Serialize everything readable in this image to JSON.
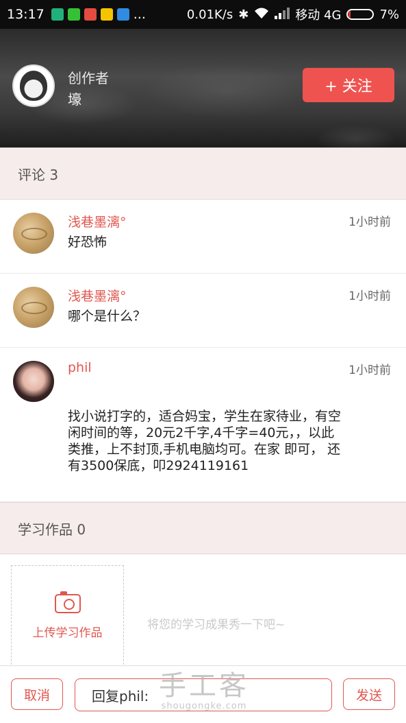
{
  "status_bar": {
    "time": "13:17",
    "dots": "...",
    "speed": "0.01K/s",
    "carrier": "移动 4G",
    "battery_percent": "7%",
    "battery_level": 0.07,
    "battery_color": "#e53935"
  },
  "header": {
    "author_label": "创作者",
    "author_name": "壕",
    "follow_label": "+ 关注"
  },
  "comments_section": {
    "title": "评论 3",
    "items": [
      {
        "name": "浅巷墨漓°",
        "time": "1小时前",
        "text": "好恐怖"
      },
      {
        "name": "浅巷墨漓°",
        "time": "1小时前",
        "text": "哪个是什么？"
      },
      {
        "name": "phil",
        "time": "1小时前",
        "text": "找小说打字的，适合妈宝，学生在家待业，有空闲时间的等，20元2千字,4千字=40元，，以此类推，上不封顶,手机电脑均可。在家 即可， 还有3500保底，叩2924119161"
      }
    ]
  },
  "works_section": {
    "title": "学习作品 0",
    "upload_label": "上传学习作品",
    "hint": "将您的学习成果秀一下吧~"
  },
  "reply_bar": {
    "cancel_label": "取消",
    "input_value": "回复phil:",
    "send_label": "发送"
  },
  "watermark": {
    "main": "手工客",
    "sub": "shougongke.com"
  },
  "colors": {
    "accent": "#e0574f",
    "follow_button": "#ef5350",
    "section_bg": "#f7ecec"
  }
}
